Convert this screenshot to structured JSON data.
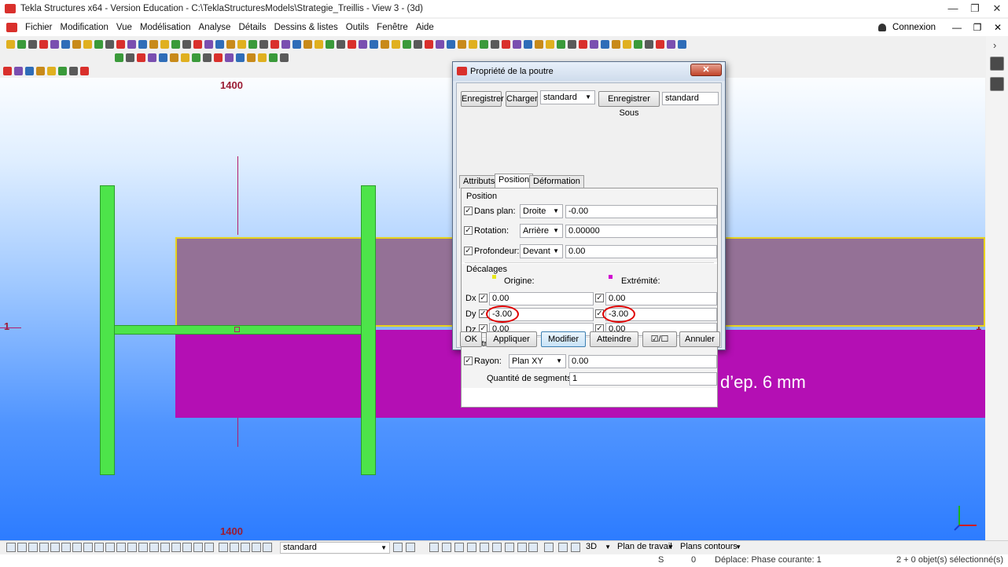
{
  "window": {
    "title": "Tekla Structures x64 - Version Education - C:\\TeklaStructuresModels\\Strategie_Treillis  - View 3 - (3d)",
    "controls": [
      "—",
      "❐",
      "✕"
    ]
  },
  "menu": {
    "items": [
      "Fichier",
      "Modification",
      "Vue",
      "Modélisation",
      "Analyse",
      "Détails",
      "Dessins & listes",
      "Outils",
      "Fenêtre",
      "Aide"
    ],
    "user": "Connexion",
    "controls": [
      "—",
      "❐",
      "✕"
    ]
  },
  "view": {
    "grid_top_label": "1400",
    "grid_bottom_label": "1400",
    "grid_left_label": "1",
    "grid_right_label": "1",
    "annotation": "+/- 3 pour insérer un gousset d’ep. 6 mm",
    "colors": {
      "profile": "#4de44a",
      "upper_plate": "#947196",
      "lower_plate": "#b40fb4",
      "outline": "#e8d21c"
    }
  },
  "dialog": {
    "title": "Propriété de la poutre",
    "close": "✕",
    "save_button": "Enregistrer",
    "load_button": "Charger",
    "attr_combo": "standard",
    "save_as_button": "Enregistrer Sous",
    "save_as_value": "standard",
    "tabs": [
      "Attributs",
      "Position",
      "Déformation"
    ],
    "position": {
      "heading": "Position",
      "rows": [
        {
          "label": "Dans plan:",
          "option": "Droite",
          "value": "-0.00"
        },
        {
          "label": "Rotation:",
          "option": "Arrière",
          "value": "0.00000"
        },
        {
          "label": "Profondeur:",
          "option": "Devant",
          "value": "0.00"
        }
      ]
    },
    "offsets": {
      "heading": "Décalages",
      "origin_label": "Origine:",
      "end_label": "Extrémité:",
      "origin_color": "#e8e81c",
      "end_color": "#d000d0",
      "rows": [
        {
          "label": "Dx",
          "origin": "0.00",
          "end": "0.00"
        },
        {
          "label": "Dy",
          "origin": "-3.00",
          "end": "-3.00"
        },
        {
          "label": "Dz",
          "origin": "0.00",
          "end": "0.00"
        }
      ]
    },
    "curved": {
      "heading": "Poutre courbe",
      "radius_label": "Rayon:",
      "plane_option": "Plan XY",
      "radius_value": "0.00",
      "segments_label": "Quantité de segments:",
      "segments_value": "1"
    },
    "buttons": {
      "ok": "OK",
      "apply": "Appliquer",
      "modify": "Modifier",
      "get": "Atteindre",
      "toggle": "☑/☐",
      "cancel": "Annuler"
    }
  },
  "bottom_toolbar": {
    "filter_combo": "standard",
    "view_mode": "3D",
    "work_plane": "Plan de travail",
    "contour_planes": "Plans contours"
  },
  "status": {
    "s": "S",
    "count": "0",
    "message": "Déplace: Phase courante: 1",
    "selection": "2 + 0 objet(s) sélectionné(s)"
  }
}
